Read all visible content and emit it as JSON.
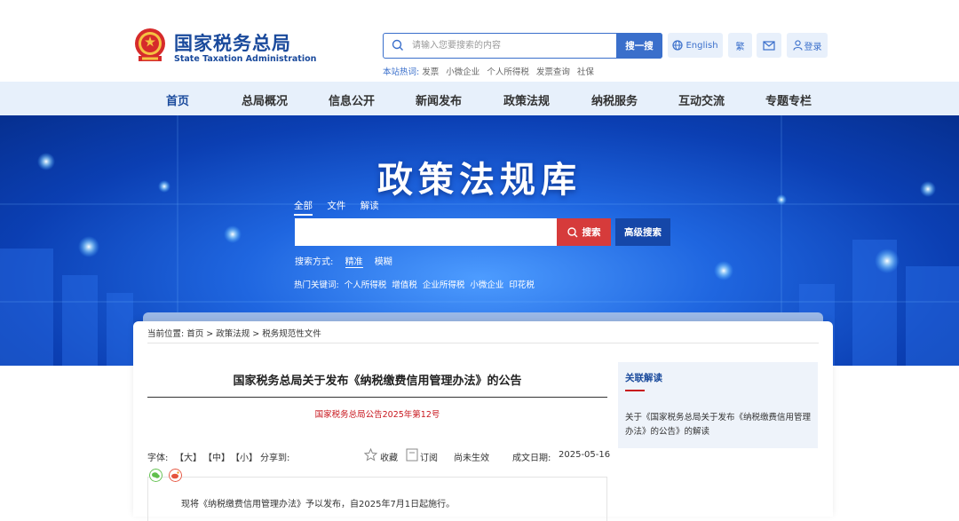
{
  "header": {
    "logo_cn": "国家税务总局",
    "logo_en": "State Taxation Administration",
    "search": {
      "placeholder": "请输入您要搜索的内容",
      "button": "搜一搜"
    },
    "english": "English",
    "traditional": "繁",
    "login": "登录",
    "hot_label": "本站热词:",
    "hot_words": [
      "发票",
      "小微企业",
      "个人所得税",
      "发票查询",
      "社保"
    ]
  },
  "nav": [
    "首页",
    "总局概况",
    "信息公开",
    "新闻发布",
    "政策法规",
    "纳税服务",
    "互动交流",
    "专题专栏"
  ],
  "banner": {
    "title": "政策法规库",
    "tabs": [
      "全部",
      "文件",
      "解读"
    ],
    "search_button": "搜索",
    "advanced_button": "高级搜索",
    "mode_label": "搜索方式:",
    "modes": [
      "精准",
      "模糊"
    ],
    "hot_label": "热门关键词:",
    "hot_keywords": [
      "个人所得税",
      "增值税",
      "企业所得税",
      "小微企业",
      "印花税"
    ]
  },
  "breadcrumb": "当前位置: 首页 > 政策法规 > 税务规范性文件",
  "document": {
    "title": "国家税务总局关于发布《纳税缴费信用管理办法》的公告",
    "number": "国家税务总局公告2025年第12号",
    "font_label": "字体:",
    "font_sizes": [
      "【大】",
      "【中】",
      "【小】"
    ],
    "share_label": "分享到:",
    "favorite": "收藏",
    "subscribe": "订阅",
    "status": "尚未生效",
    "date_label": "成文日期:",
    "date": "2025-05-16",
    "body": "现将《纳税缴费信用管理办法》予以发布，自2025年7月1日起施行。"
  },
  "related": {
    "title": "关联解读",
    "link": "关于《国家税务总局关于发布《纳税缴费信用管理办法》的公告》的解读"
  },
  "colors": {
    "brand": "#1a4a9c",
    "accent": "#3a6fcb",
    "red": "#c8161d"
  }
}
